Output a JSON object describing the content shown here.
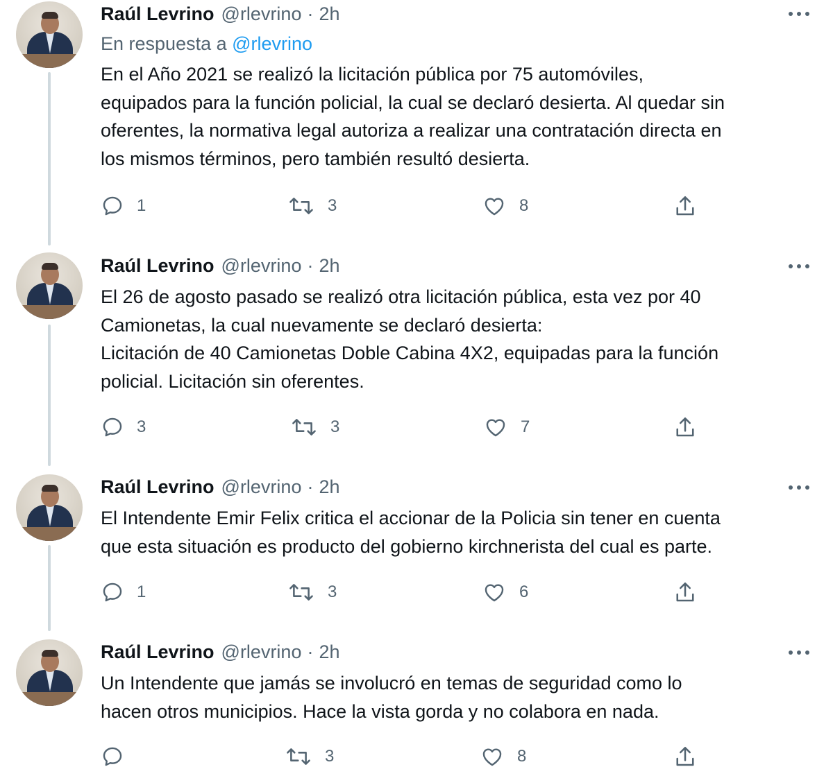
{
  "tweets": [
    {
      "author": "Raúl Levrino",
      "handle": "@rlevrino",
      "separator": "·",
      "time": "2h",
      "reply_prefix": "En respuesta a",
      "reply_mention": "@rlevrino",
      "lines": [
        "En el Año 2021 se realizó la licitación pública por 75 automóviles,",
        "equipados para la función policial, la cual se declaró desierta. Al quedar sin",
        "oferentes, la normativa legal autoriza a realizar una contratación directa en",
        "los mismos términos, pero también resultó desierta."
      ],
      "replies": "1",
      "retweets": "3",
      "likes": "8"
    },
    {
      "author": "Raúl Levrino",
      "handle": "@rlevrino",
      "separator": "·",
      "time": "2h",
      "lines": [
        "El 26 de agosto pasado se realizó otra licitación pública, esta vez por 40",
        "Camionetas, la cual nuevamente se declaró desierta:",
        "Licitación de 40 Camionetas Doble Cabina 4X2, equipadas para la función",
        "policial. Licitación sin oferentes."
      ],
      "replies": "3",
      "retweets": "3",
      "likes": "7"
    },
    {
      "author": "Raúl Levrino",
      "handle": "@rlevrino",
      "separator": "·",
      "time": "2h",
      "lines": [
        "El Intendente Emir Felix critica el accionar de la Policia sin tener en cuenta",
        "que esta situación es producto del gobierno kirchnerista del cual es parte."
      ],
      "replies": "1",
      "retweets": "3",
      "likes": "6"
    },
    {
      "author": "Raúl Levrino",
      "handle": "@rlevrino",
      "separator": "·",
      "time": "2h",
      "lines": [
        "Un Intendente que jamás se involucró en temas de seguridad como lo",
        "hacen otros municipios. Hace la vista gorda y no colabora en nada."
      ],
      "replies": "",
      "retweets": "3",
      "likes": "8"
    }
  ],
  "icons": {
    "reply": "reply-icon",
    "retweet": "retweet-icon",
    "like": "like-icon",
    "share": "share-icon",
    "more": "more-options-icon"
  },
  "colors": {
    "text": "#0f1419",
    "secondary": "#536471",
    "link": "#1d9bf0",
    "thread_line": "#cfd9de"
  }
}
